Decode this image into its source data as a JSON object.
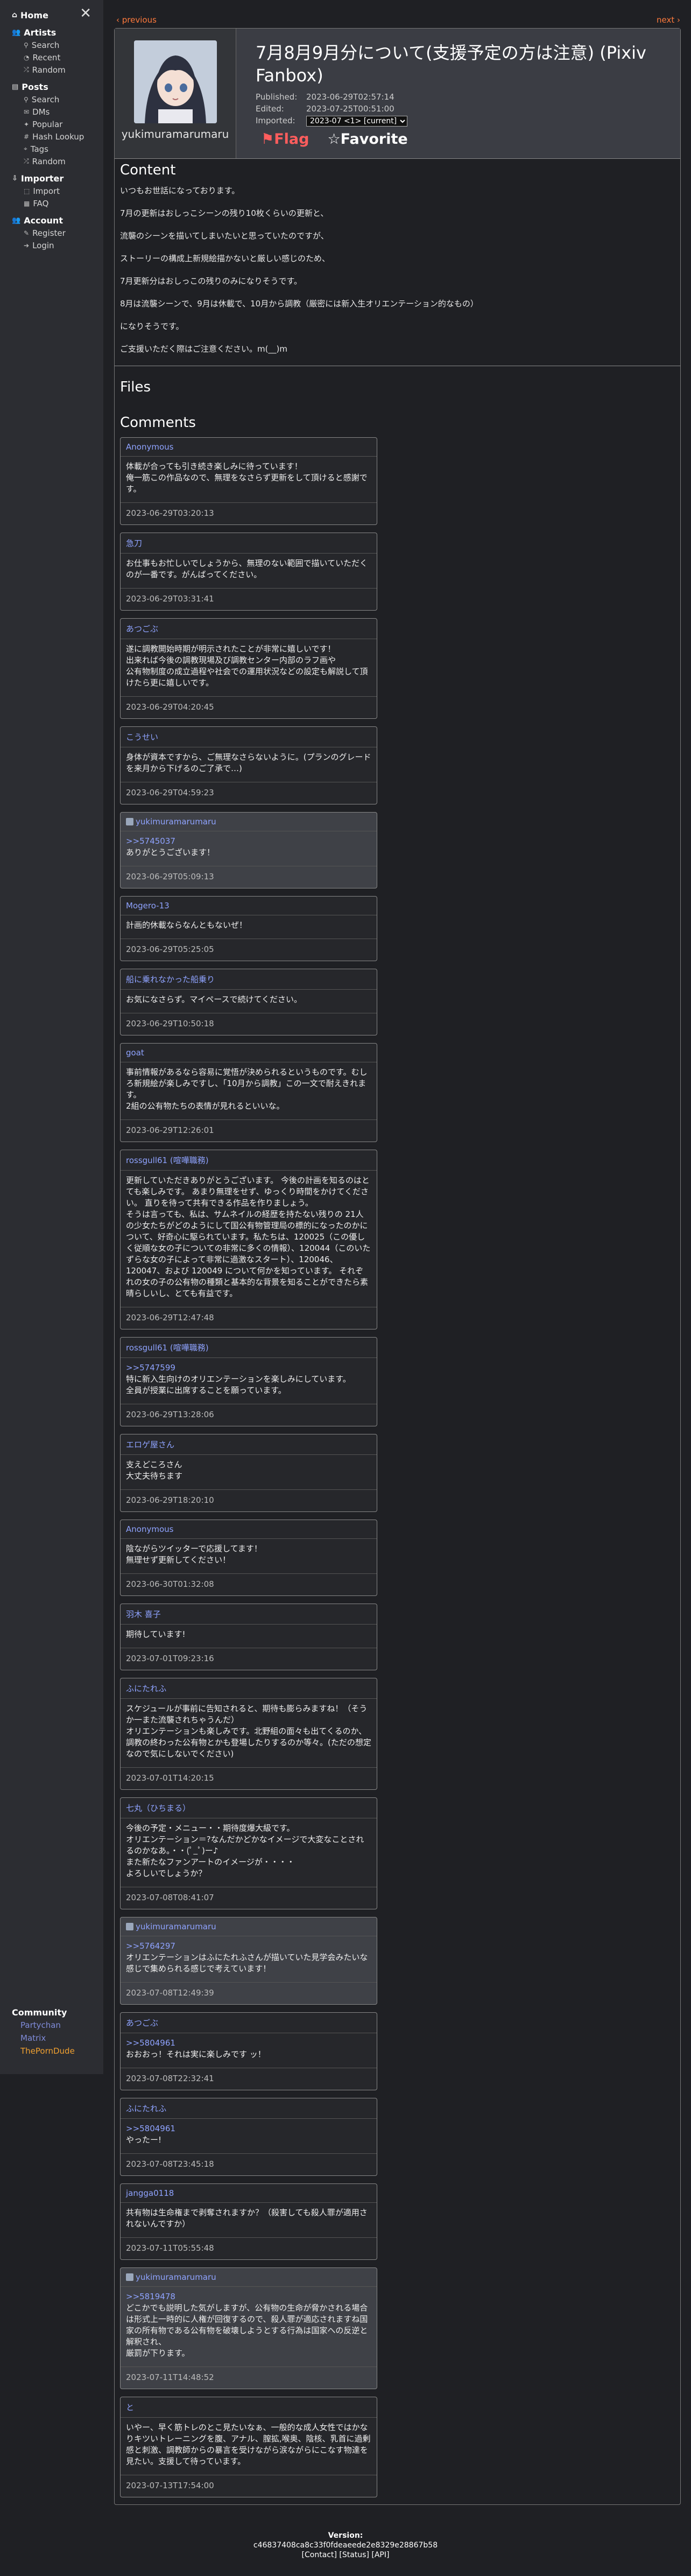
{
  "sidebar": {
    "home": "Home",
    "sections": [
      {
        "title": "Artists",
        "items": [
          "Search",
          "Recent",
          "Random"
        ]
      },
      {
        "title": "Posts",
        "items": [
          "Search",
          "DMs",
          "Popular",
          "Hash Lookup",
          "Tags",
          "Random"
        ]
      },
      {
        "title": "Importer",
        "items": [
          "Import",
          "FAQ"
        ]
      },
      {
        "title": "Account",
        "items": [
          "Register",
          "Login"
        ]
      }
    ],
    "community": {
      "title": "Community",
      "links": [
        {
          "label": "Partychan",
          "color": "#7f8bd9"
        },
        {
          "label": "Matrix",
          "color": "#7f8bd9"
        },
        {
          "label": "ThePornDude",
          "color": "#f0a030"
        }
      ]
    }
  },
  "pager": {
    "prev": "‹ previous",
    "next": "next ›"
  },
  "post": {
    "artist_name": "yukimuramarumaru",
    "title": "7月8月9月分について(支援予定の方は注意) (Pixiv Fanbox)",
    "published_label": "Published:",
    "published": "2023-06-29T02:57:14",
    "edited_label": "Edited:",
    "edited": "2023-07-25T00:51:00",
    "imported_label": "Imported:",
    "imported": "2023-07 <1> [current]",
    "flag": "⚑Flag",
    "favorite": "☆Favorite",
    "content_heading": "Content",
    "content": [
      "いつもお世話になっております。",
      "7月の更新はおしっこシーンの残り10枚くらいの更新と、",
      "流襲のシーンを描いてしまいたいと思っていたのですが、",
      "ストーリーの構成上新規絵描かないと厳しい感じのため、",
      "7月更新分はおしっこの残りのみになりそうです。",
      "8月は流襲シーンで、9月は休載で、10月から調教（厳密には新入生オリエンテーション的なもの）",
      "になりそうです。",
      "ご支援いただく際はご注意ください。m(__)m"
    ],
    "files_heading": "Files",
    "comments_heading": "Comments"
  },
  "comments": [
    {
      "author": "Anonymous",
      "artist": false,
      "body": "体載が合っても引き続き楽しみに待っています！\n俺一筋この作品なので、無理をなさらず更新をして頂けると感謝です。",
      "date": "2023-06-29T03:20:13"
    },
    {
      "author": "急刀",
      "artist": false,
      "body": "お仕事もお忙しいでしょうから、無理のない範囲で描いていただくのが一番です。がんばってください。",
      "date": "2023-06-29T03:31:41"
    },
    {
      "author": "あつごぶ",
      "artist": false,
      "body": "遂に調教開始時期が明示されたことが非常に嬉しいです！\n出来れば今後の調教現場及び調教センター内部のラフ画や\n公有物制度の成立過程や社会での運用状況などの設定も解説して頂けたら更に嬉しいです。",
      "date": "2023-06-29T04:20:45"
    },
    {
      "author": "こうせい",
      "artist": false,
      "body": "身体が資本ですから、ご無理なさらないように。(プランのグレードを来月から下げるのご了承で…)",
      "date": "2023-06-29T04:59:23"
    },
    {
      "author": "yukimuramarumaru",
      "artist": true,
      "ref": ">>5745037",
      "body": "ありがとうございます！",
      "date": "2023-06-29T05:09:13"
    },
    {
      "author": "Mogero-13",
      "artist": false,
      "body": "計画的休載ならなんともないぜ！",
      "date": "2023-06-29T05:25:05"
    },
    {
      "author": "船に乗れなかった船乗り",
      "artist": false,
      "body": "お気になさらず。マイペースで続けてください。",
      "date": "2023-06-29T10:50:18"
    },
    {
      "author": "goat",
      "artist": false,
      "body": "事前情報があるなら容易に覚悟が決められるというものです。むしろ新規絵が楽しみですし、「10月から調教」この一文で耐えきれます。\n2組の公有物たちの表情が見れるといいな。",
      "date": "2023-06-29T12:26:01"
    },
    {
      "author": "rossgull61 (喧嘩職務)",
      "artist": false,
      "body": "更新していただきありがとうございます。 今後の計画を知るのはとても楽しみです。 あまり無理をせず、ゆっくり時間をかけてください。 直りを待って共有できる作品を作りましょう。\nそうは言っても、私は、サムネイルの経歴を持たない残りの 21人の少女たちがどのようにして国公有物管理局の標的になったのかについて、好奇心に駆られています。私たちは、120025（この優しく従順な女の子についての非常に多くの情報）、120044（このいたずらな女の子によって非常に過激なスタート）、120046、120047、および 120049 について何かを知っています。 それぞれの女の子の公有物の種類と基本的な背景を知ることができたら素晴らしいし、とても有益です。",
      "date": "2023-06-29T12:47:48"
    },
    {
      "author": "rossgull61 (喧嘩職務)",
      "artist": false,
      "ref": ">>5747599",
      "body": "特に新入生向けのオリエンテーションを楽しみにしています。\n全員が授業に出席することを願っています。",
      "date": "2023-06-29T13:28:06"
    },
    {
      "author": "エロゲ屋さん",
      "artist": false,
      "body": "支えどころさん\n大丈夫待ちます",
      "date": "2023-06-29T18:20:10"
    },
    {
      "author": "Anonymous",
      "artist": false,
      "body": "陰ながらツイッターで応援してます！\n無理せず更新してください！",
      "date": "2023-06-30T01:32:08"
    },
    {
      "author": "羽木 喜子",
      "artist": false,
      "body": "期待しています!",
      "date": "2023-07-01T09:23:16"
    },
    {
      "author": "ふにたれふ",
      "artist": false,
      "body": "スケジュールが事前に告知されると、期待も膨らみますね！（そうか一また流襲されちゃうんだ）\nオリエンテーションも楽しみです。北野組の面々も出てくるのか、調教の終わった公有物とかも登場したりするのか等々。(ただの想定なので気にしないでください)",
      "date": "2023-07-01T14:20:15"
    },
    {
      "author": "七丸（ひちまる）",
      "artist": false,
      "body": "今後の予定・メニュー・・期待度爆大級です。\nオリエンテーション＝?なんだかどかなイメージで大変なことされるのかなあ。・・(ﾟ_ﾟ)ー♪\nまた新たなファンアートのイメージが・・・・\nよろしいでしょうか？",
      "date": "2023-07-08T08:41:07"
    },
    {
      "author": "yukimuramarumaru",
      "artist": true,
      "ref": ">>5764297",
      "body": "オリエンテーションはふにたれふさんが描いていた見学会みたいな感じで集められる感じで考えています！",
      "date": "2023-07-08T12:49:39"
    },
    {
      "author": "あつごぶ",
      "artist": false,
      "ref": ">>5804961",
      "body": "おおおっ！それは実に楽しみです ッ！",
      "date": "2023-07-08T22:32:41"
    },
    {
      "author": "ふにたれふ",
      "artist": false,
      "ref": ">>5804961",
      "body": "やったー!",
      "date": "2023-07-08T23:45:18"
    },
    {
      "author": "jangga0118",
      "artist": false,
      "body": "共有物は生命権まで剥奪されますか？（殺害しても殺人罪が適用されないんですか）",
      "date": "2023-07-11T05:55:48"
    },
    {
      "author": "yukimuramarumaru",
      "artist": true,
      "ref": ">>5819478",
      "body": "どこかでも説明した気がしますが、公有物の生命が脅かされる場合は形式上一時的に人権が回復するので、殺人罪が適応されますね国家の所有物である公有物を破壊しようとする行為は国家への反逆と解釈され、\n厳罰が下ります。",
      "date": "2023-07-11T14:48:52"
    },
    {
      "author": "と",
      "artist": false,
      "body": "いやー、早く筋トレのとこ見たいなぁ、一般的な成人女性ではかなりキツいトレーニングを腹、アナル、膣拡,喉奥、陰核、乳首に過剰感と刺激、調教師からの暴言を受けながら涙ながらにこなす物達を見たい。支援して待っています。",
      "date": "2023-07-13T17:54:00"
    }
  ],
  "footer": {
    "version_label": "Version:",
    "version": "c46837408ca8c33f0fdeaeede2e8329e28867b58",
    "links": "[Contact] [Status] [API]"
  }
}
